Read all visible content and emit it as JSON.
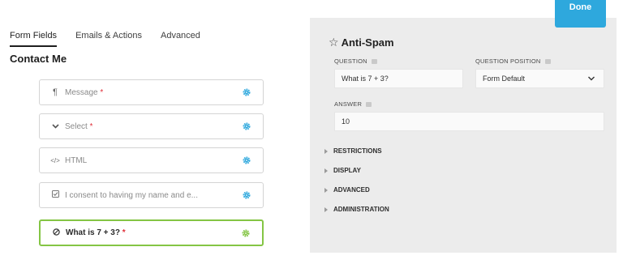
{
  "tabs": [
    {
      "label": "Form Fields",
      "active": true
    },
    {
      "label": "Emails & Actions",
      "active": false
    },
    {
      "label": "Advanced",
      "active": false
    }
  ],
  "form_title": "Contact Me",
  "fields": [
    {
      "icon": "paragraph-icon",
      "label": "Message",
      "required": "*"
    },
    {
      "icon": "chevron-down-icon",
      "label": "Select",
      "required": "*"
    },
    {
      "icon": "code-icon",
      "label": "HTML",
      "required": ""
    },
    {
      "icon": "checkbox-icon",
      "label": "I consent to having my name and e...",
      "required": ""
    },
    {
      "icon": "ban-icon",
      "label": "What is 7 + 3?",
      "required": "*"
    }
  ],
  "panel": {
    "done_label": "Done",
    "title": "Anti-Spam",
    "question_label": "QUESTION",
    "question_value": "What is 7 + 3?",
    "position_label": "QUESTION POSITION",
    "position_value": "Form Default",
    "answer_label": "ANSWER",
    "answer_value": "10",
    "sections": [
      "RESTRICTIONS",
      "DISPLAY",
      "ADVANCED",
      "ADMINISTRATION"
    ]
  },
  "colors": {
    "accent_blue": "#2ea8dd",
    "selected_green": "#84c544",
    "required_red": "#e0303a"
  }
}
